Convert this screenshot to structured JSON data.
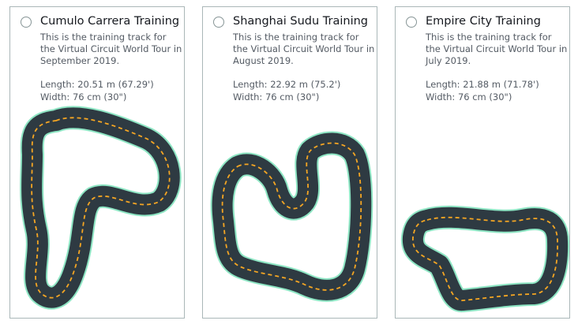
{
  "tracks": [
    {
      "name": "Cumulo Carrera Training",
      "description": "This is the training track for the Virtual Circuit World Tour in September 2019.",
      "length": "Length: 20.51 m (67.29')",
      "width": "Width: 76 cm (30\")"
    },
    {
      "name": "Shanghai Sudu Training",
      "description": "This is the training track for the Virtual Circuit World Tour in August 2019.",
      "length": "Length: 22.92 m (75.2')",
      "width": "Width: 76 cm (30\")"
    },
    {
      "name": "Empire City Training",
      "description": "This is the training track for the Virtual Circuit World Tour in July 2019.",
      "length": "Length: 21.88 m (71.78')",
      "width": "Width: 76 cm (30\")"
    }
  ],
  "colors": {
    "track_surface": "#2e3a42",
    "track_border": "#8ee6c4",
    "center_line": "#f5a623",
    "card_border": "#aab7b8"
  },
  "icons": {
    "radio": "radio-unselected",
    "track_map": "track-map"
  }
}
